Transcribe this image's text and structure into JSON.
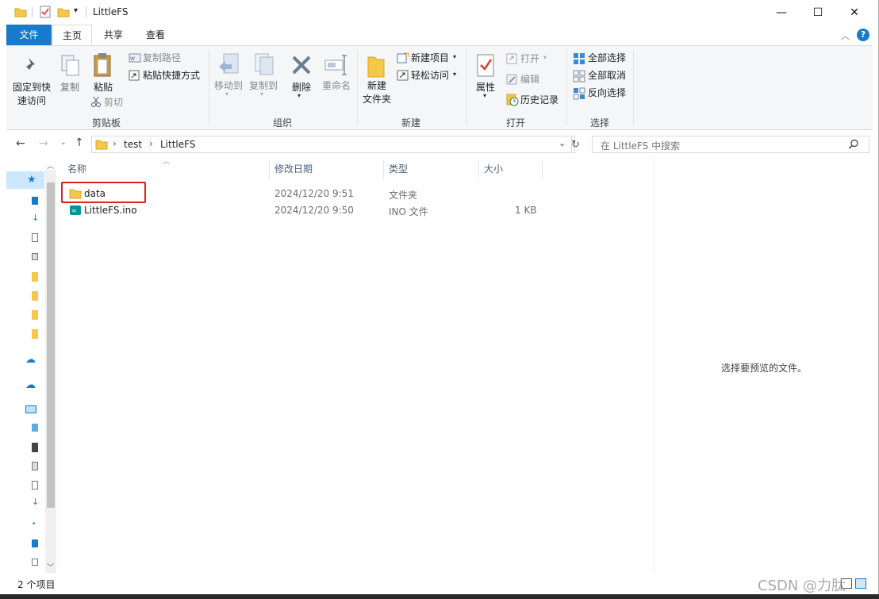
{
  "window": {
    "title": "LittleFS",
    "controls": {
      "minimize": "—",
      "maximize": "☐",
      "close": "✕"
    }
  },
  "ribbon_tabs": [
    {
      "label": "文件"
    },
    {
      "label": "主页"
    },
    {
      "label": "共享"
    },
    {
      "label": "查看"
    }
  ],
  "help": {
    "label": "?"
  },
  "ribbon": {
    "clipboard": {
      "label": "剪贴板",
      "pin": "固定到快\n速访问",
      "copy": "复制",
      "paste": "粘贴",
      "copy_path": "复制路径",
      "paste_shortcut": "粘贴快捷方式",
      "cut": "剪切"
    },
    "organize": {
      "label": "组织",
      "move_to": "移动到",
      "copy_to": "复制到",
      "delete": "删除",
      "rename": "重命名"
    },
    "new": {
      "label": "新建",
      "new_folder": "新建\n文件夹",
      "new_item": "新建项目",
      "easy_access": "轻松访问"
    },
    "open": {
      "label": "打开",
      "properties": "属性",
      "open": "打开",
      "edit": "编辑",
      "history": "历史记录"
    },
    "select": {
      "label": "选择",
      "select_all": "全部选择",
      "select_none": "全部取消",
      "invert": "反向选择"
    }
  },
  "address": {
    "breadcrumb": [
      "test",
      "LittleFS"
    ],
    "search_placeholder": "在 LittleFS 中搜索"
  },
  "columns": {
    "name": "名称",
    "date": "修改日期",
    "type": "类型",
    "size": "大小"
  },
  "files": [
    {
      "name": "data",
      "date": "2024/12/20 9:51",
      "type": "文件夹",
      "size": ""
    },
    {
      "name": "LittleFS.ino",
      "date": "2024/12/20 9:50",
      "type": "INO 文件",
      "size": "1 KB"
    }
  ],
  "preview": {
    "message": "选择要预览的文件。"
  },
  "status": {
    "count": "2 个项目"
  },
  "watermark": "CSDN @力肽",
  "colors": {
    "file_tab": "#1979ca",
    "highlight_box": "#e02020",
    "folder": "#f5c84c"
  }
}
